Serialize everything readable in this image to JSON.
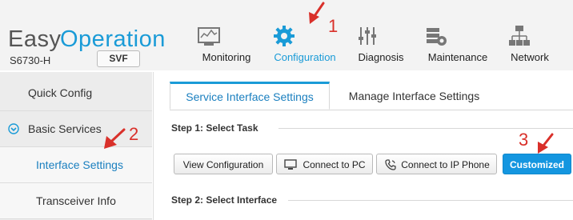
{
  "brand": {
    "easy": "Easy",
    "operation": "Operation",
    "model": "S6730-H",
    "svf_label": "SVF"
  },
  "nav": [
    {
      "label": "Monitoring",
      "icon": "monitor-icon"
    },
    {
      "label": "Configuration",
      "icon": "gear-icon",
      "active": true
    },
    {
      "label": "Diagnosis",
      "icon": "sliders-icon"
    },
    {
      "label": "Maintenance",
      "icon": "maintenance-icon"
    },
    {
      "label": "Network",
      "icon": "network-icon"
    }
  ],
  "sidebar": {
    "quick_config": "Quick Config",
    "basic_services": "Basic Services",
    "interface_settings": "Interface Settings",
    "transceiver_info": "Transceiver Info"
  },
  "tabs": {
    "active": "Service Interface Settings",
    "inactive": "Manage Interface Settings"
  },
  "steps": {
    "step1": "Step 1: Select Task",
    "step2": "Step 2: Select Interface"
  },
  "buttons": {
    "view_configuration": "View Configuration",
    "connect_pc": "Connect to PC",
    "connect_ip_phone": "Connect to IP Phone",
    "customized": "Customized"
  },
  "annotations": {
    "n1": "1",
    "n2": "2",
    "n3": "3"
  },
  "colors": {
    "accent": "#1a9bd7",
    "annotation": "#d9302a",
    "primary_button": "#1496e0"
  }
}
